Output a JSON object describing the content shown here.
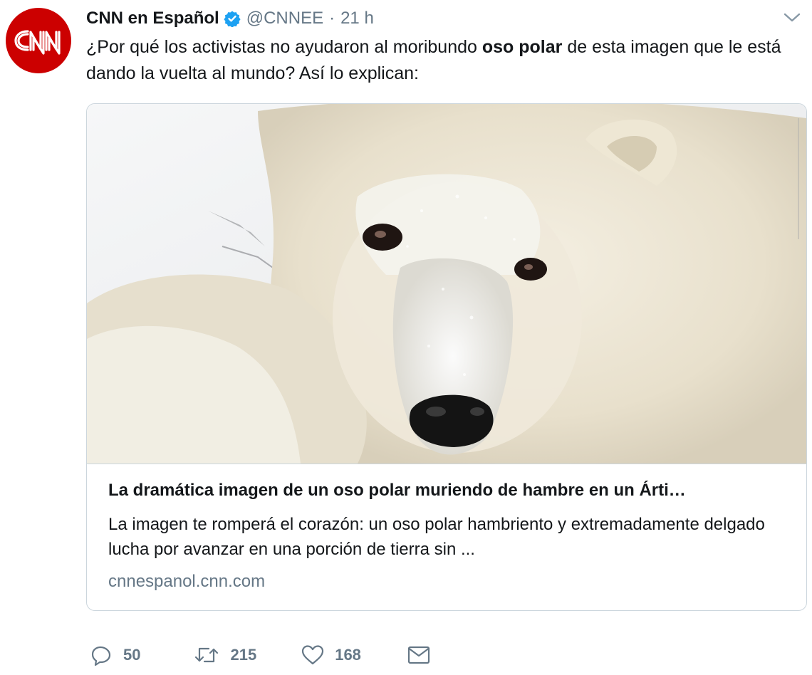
{
  "tweet": {
    "author_name": "CNN en Español",
    "handle": "@CNNEE",
    "separator": "·",
    "timestamp": "21 h",
    "avatar_logo": "CNN",
    "text_before": "¿Por qué los activistas no ayudaron al moribundo ",
    "text_bold": "oso polar",
    "text_after": " de esta imagen que le está dando la vuelta al mundo? Así lo explican:"
  },
  "card": {
    "image_icon": "polar-bear-photo",
    "title": "La dramática imagen de un oso polar muriendo de hambre en un Árti…",
    "description": "La imagen te romperá el corazón: un oso polar hambriento y extremadamente delgado lucha por avanzar en una porción de tierra sin ...",
    "domain": "cnnespanol.cnn.com"
  },
  "actions": {
    "reply_count": "50",
    "retweet_count": "215",
    "like_count": "168"
  },
  "colors": {
    "brand_red": "#cc0000",
    "verified_blue": "#1da1f2",
    "muted": "#657786",
    "border": "#ccd6dd"
  }
}
